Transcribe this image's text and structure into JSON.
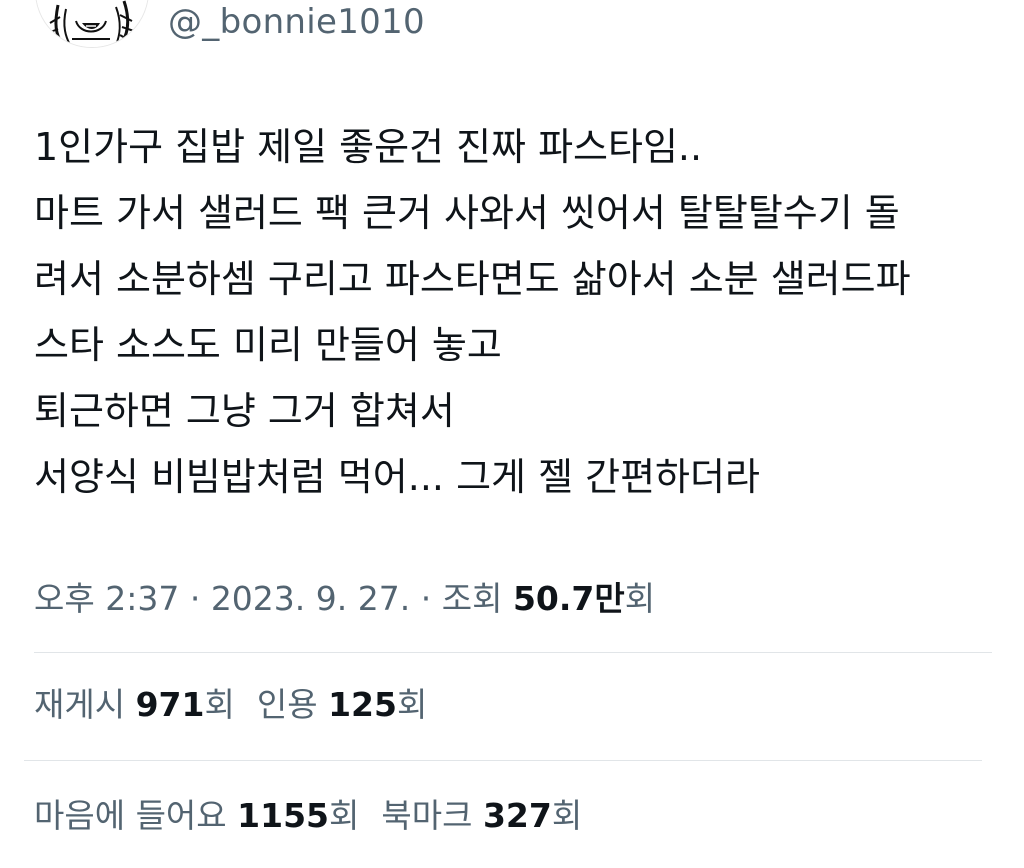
{
  "author": {
    "handle": "@_bonnie1010",
    "avatar_icon": "cartoon-girl-avatar-icon"
  },
  "tweet": {
    "lines": [
      "1인가구 집밥 제일 좋운건 진짜 파스타임..",
      "마트 가서 샐러드 팩 큰거 사와서 씻어서 탈탈탈수기 돌",
      "려서 소분하셈 구리고 파스타면도 삶아서 소분 샐러드파",
      "스타 소스도 미리 만들어 놓고",
      "퇴근하면 그냥 그거 합쳐서",
      "서양식 비빔밥처럼 먹어... 그게 젤 간편하더라"
    ]
  },
  "meta": {
    "time": "오후 2:37",
    "separator": " · ",
    "date": "2023. 9. 27.",
    "views_label": "조회 ",
    "views_count": "50.7만",
    "views_suffix": "회"
  },
  "stats": {
    "reposts_label": "재게시 ",
    "reposts_count": "971",
    "reposts_suffix": "회",
    "quotes_label": "인용 ",
    "quotes_count": "125",
    "quotes_suffix": "회",
    "likes_label": "마음에 들어요 ",
    "likes_count": "1155",
    "likes_suffix": "회",
    "bookmarks_label": "북마크 ",
    "bookmarks_count": "327",
    "bookmarks_suffix": "회"
  },
  "colors": {
    "text_primary": "#0f1419",
    "text_secondary": "#536471",
    "divider": "#e1e5e8"
  }
}
